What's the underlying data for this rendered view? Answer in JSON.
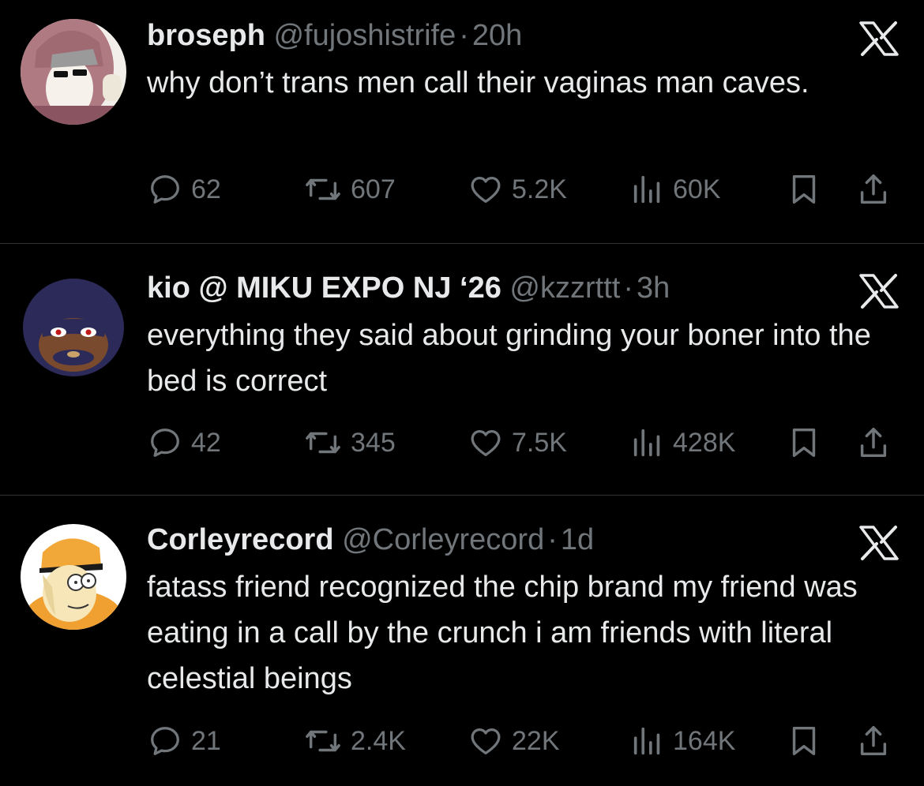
{
  "colors": {
    "background": "#000000",
    "text_primary": "#e7e9ea",
    "text_secondary": "#71767b",
    "divider": "#2f3336"
  },
  "tweets": [
    {
      "display_name": "broseph",
      "handle": "@fujoshistrife",
      "separator": "·",
      "time": "20h",
      "text": "why don’t trans men call their vaginas man caves.",
      "replies": "62",
      "retweets": "607",
      "likes": "5.2K",
      "views": "60K",
      "avatar_icon": "avatar-pink-hoodie-sunglasses"
    },
    {
      "display_name": "kio @ MIKU EXPO NJ ‘26",
      "handle": "@kzzrttt",
      "separator": "·",
      "time": "3h",
      "text": "everything they said about grinding your boner into the bed is correct",
      "replies": "42",
      "retweets": "345",
      "likes": "7.5K",
      "views": "428K",
      "avatar_icon": "avatar-blue-mask-character"
    },
    {
      "display_name": "Corleyrecord",
      "handle": "@Corleyrecord",
      "separator": "·",
      "time": "1d",
      "text": "fatass friend recognized the chip brand my friend was eating in a call by the crunch i am friends with literal celestial beings",
      "replies": "21",
      "retweets": "2.4K",
      "likes": "22K",
      "views": "164K",
      "avatar_icon": "avatar-cartoon-man-orange-cap"
    }
  ]
}
